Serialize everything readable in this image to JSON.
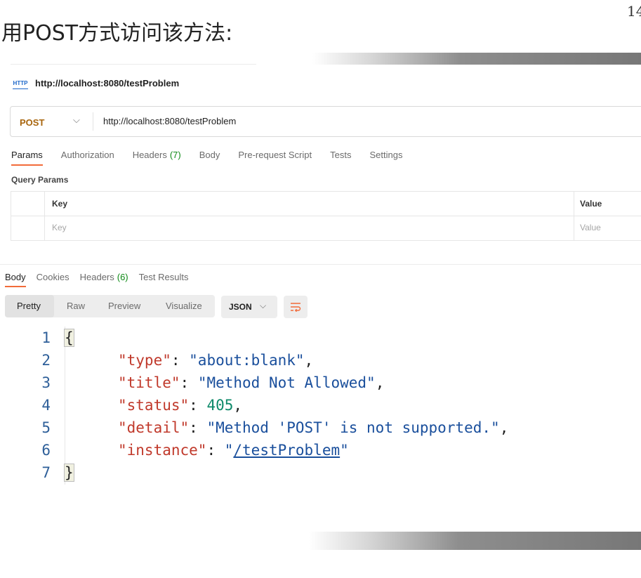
{
  "slide": {
    "title": "用POST方式访问该方法:",
    "page_number": "14"
  },
  "request": {
    "icon_label": "HTTP",
    "name": "http://localhost:8080/testProblem",
    "method": "POST",
    "url": "http://localhost:8080/testProblem",
    "tabs": {
      "params": "Params",
      "authorization": "Authorization",
      "headers": "Headers",
      "headers_count": "(7)",
      "body": "Body",
      "prerequest": "Pre-request Script",
      "tests": "Tests",
      "settings": "Settings"
    },
    "query_params": {
      "label": "Query Params",
      "col_key": "Key",
      "col_value": "Value",
      "key_placeholder": "Key",
      "value_placeholder": "Value"
    }
  },
  "response": {
    "tabs": {
      "body": "Body",
      "cookies": "Cookies",
      "headers": "Headers",
      "headers_count": "(6)",
      "test_results": "Test Results"
    },
    "views": {
      "pretty": "Pretty",
      "raw": "Raw",
      "preview": "Preview",
      "visualize": "Visualize"
    },
    "format": "JSON",
    "code": {
      "line_numbers": [
        "1",
        "2",
        "3",
        "4",
        "5",
        "6",
        "7"
      ],
      "open_brace": "{",
      "close_brace": "}",
      "type_key": "\"type\"",
      "type_val": "\"about:blank\"",
      "title_key": "\"title\"",
      "title_val": "\"Method Not Allowed\"",
      "status_key": "\"status\"",
      "status_val": "405",
      "detail_key": "\"detail\"",
      "detail_val": "\"Method 'POST' is not supported.\"",
      "instance_key": "\"instance\"",
      "instance_val": "/testProblem"
    }
  },
  "colors": {
    "accent": "#f26b3a",
    "method": "#a8650d",
    "count": "#0e8a16"
  }
}
